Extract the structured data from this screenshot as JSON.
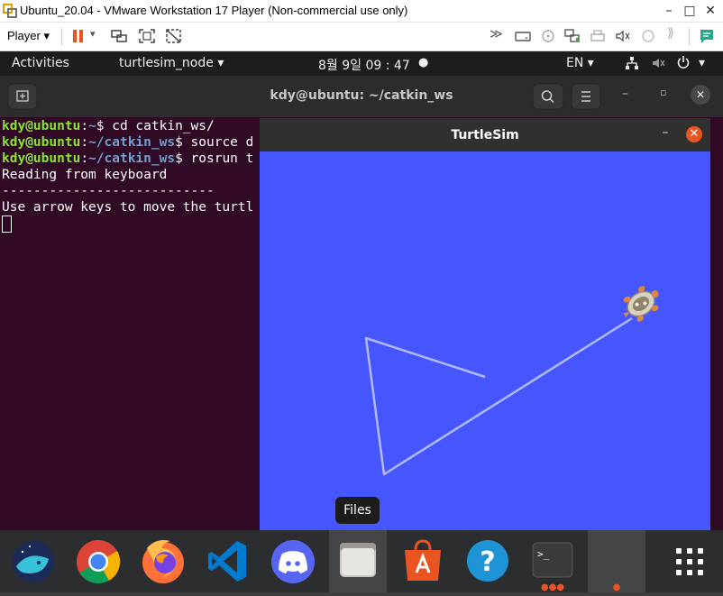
{
  "vm": {
    "title": "Ubuntu_20.04 - VMware Workstation 17 Player (Non-commercial use only)",
    "player_label": "Player",
    "minimize": "–",
    "maximize": "□",
    "close": "✕"
  },
  "topbar": {
    "activities": "Activities",
    "app_menu": "turtlesim_node",
    "clock": "8월 9일  09 : 47",
    "language": "EN"
  },
  "terminal": {
    "title": "kdy@ubuntu: ~/catkin_ws",
    "lines": [
      {
        "user": "kdy@ubuntu",
        "path": "~",
        "cmd": "$ cd catkin_ws/"
      },
      {
        "user": "kdy@ubuntu",
        "path": "~/catkin_ws",
        "cmd": "$ source d"
      },
      {
        "user": "kdy@ubuntu",
        "path": "~/catkin_ws",
        "cmd": "$ rosrun t"
      }
    ],
    "output": [
      "Reading from keyboard",
      "---------------------------",
      "Use arrow keys to move the turtl"
    ]
  },
  "turtlesim": {
    "title": "TurtleSim",
    "bg_color": "#4556ff",
    "pen_color": "#b3b8ff"
  },
  "tooltip": "Files",
  "dock": {
    "items": [
      {
        "name": "naver-whale"
      },
      {
        "name": "chrome"
      },
      {
        "name": "firefox"
      },
      {
        "name": "vscode"
      },
      {
        "name": "discord"
      },
      {
        "name": "files"
      },
      {
        "name": "software"
      },
      {
        "name": "help"
      },
      {
        "name": "terminal"
      },
      {
        "name": "turtlesim"
      },
      {
        "name": "show-apps"
      }
    ]
  },
  "colors": {
    "ubuntu_orange": "#e95420",
    "terminal_bg": "#300a24",
    "prompt_user": "#8ae234",
    "prompt_path": "#729fcf"
  }
}
